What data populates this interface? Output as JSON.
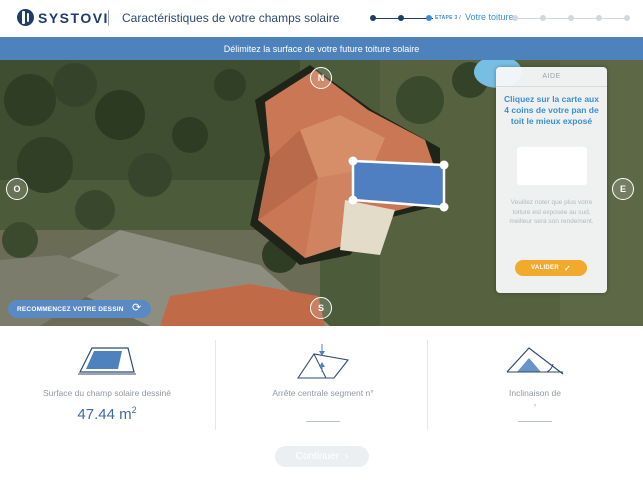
{
  "header": {
    "brand": "SYSTOVI",
    "title": "Caractéristiques de votre champs solaire",
    "step_small": "ETAPE 3 /",
    "step_label": "Votre toiture"
  },
  "banner": {
    "text": "Délimitez la surface de votre future toiture solaire"
  },
  "map": {
    "compass": {
      "north": "N",
      "south": "S",
      "east": "E",
      "west": "O"
    },
    "restart_label": "RECOMMENCEZ VOTRE DESSIN",
    "restart_icon": "refresh-icon"
  },
  "help": {
    "title": "AIDE",
    "instruction": "Cliquez sur la carte aux 4 coins de votre pan de toit le mieux exposé",
    "note": "Veuillez noter que plus votre toiture est exposée au sud, meilleur sera son rendement.",
    "validate_label": "VALIDER",
    "validate_icon": "check-icon"
  },
  "stats": {
    "surface": {
      "label": "Surface du champ solaire dessiné",
      "value": "47.44 m",
      "unit_sup": "2",
      "icon": "solar-panel-icon"
    },
    "ridge": {
      "label": "Arrête centrale segment n°",
      "icon": "roof-ridge-icon"
    },
    "inclination": {
      "label": "Inclinaison de",
      "degree": "°",
      "icon": "roof-angle-icon"
    }
  },
  "footer": {
    "continue_label": "Continuer",
    "continue_icon": "chevron-right-icon"
  },
  "colors": {
    "brand_navy": "#1d3d6b",
    "accent_blue": "#3a8fd0",
    "banner_blue": "#4d82bd",
    "validate_orange": "#f2aa2c",
    "selection_fill": "#4f7fc0"
  }
}
